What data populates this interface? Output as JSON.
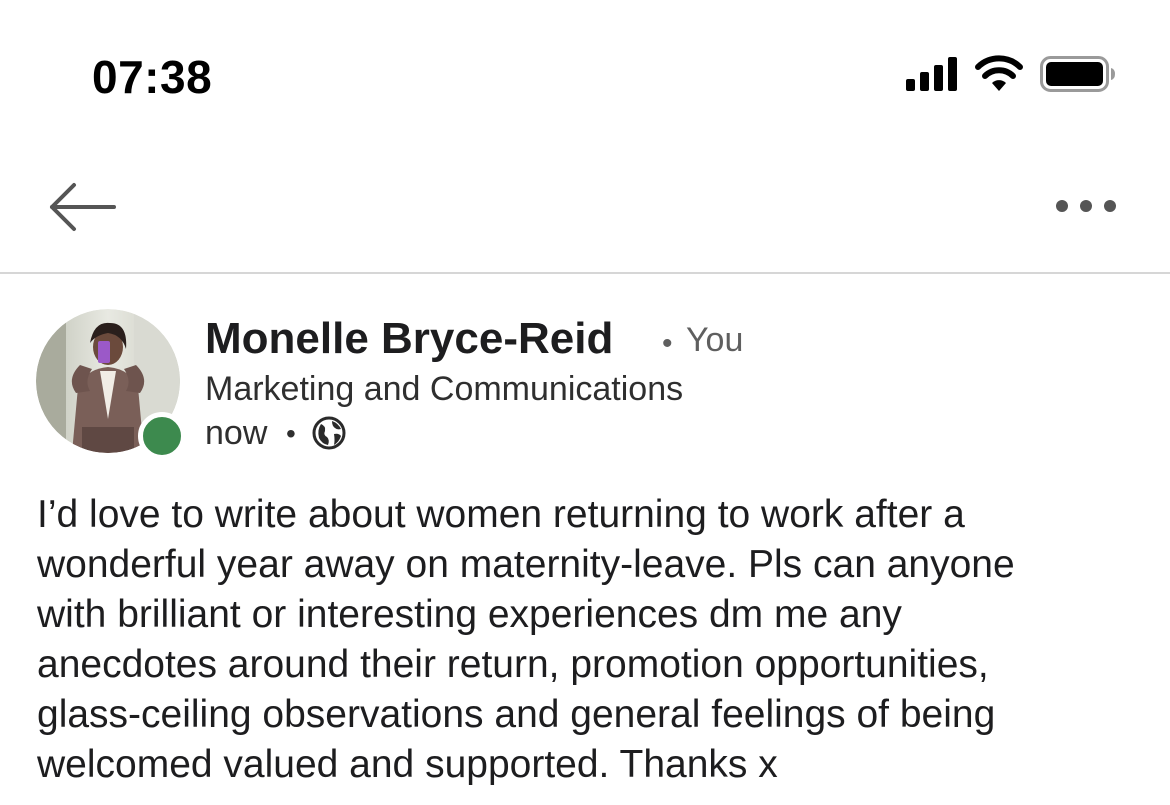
{
  "status_bar": {
    "time": "07:38",
    "signal_icon": "cellular-signal-icon",
    "wifi_icon": "wifi-icon",
    "battery_icon": "battery-icon"
  },
  "nav": {
    "back_icon": "arrow-left-icon",
    "more_icon": "ellipsis-icon"
  },
  "post": {
    "author": {
      "name": "Monelle Bryce-Reid",
      "separator": "•",
      "degree": "You",
      "headline": "Marketing and Communications",
      "presence_color": "#3d8a4e"
    },
    "time": "now",
    "time_separator": "•",
    "visibility_icon": "globe-icon",
    "body": "I’d love to write about women returning to work after a\nwonderful year away on maternity-leave. Pls can anyone\nwith brilliant or interesting experiences dm me any\nanecdotes around their return, promotion opportunities,\nglass-ceiling observations and general feelings of being\nwelcomed valued and supported. Thanks x"
  }
}
